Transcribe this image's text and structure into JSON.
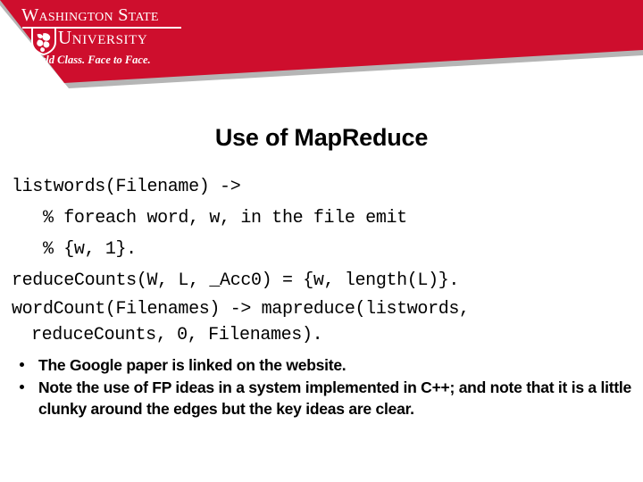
{
  "banner": {
    "brand_color": "#ce0e2d",
    "shadow_color": "#b5b5b5",
    "wordmark_line1": "Washington State",
    "wordmark_line2": "University",
    "tagline": "World Class. Face to Face.",
    "shield_icon": "wsu-cougar-shield-icon"
  },
  "slide": {
    "title": "Use of MapReduce",
    "code_lines": [
      "listwords(Filename) ->",
      "   % foreach word, w, in the file emit",
      "   % {w, 1}.",
      "reduceCounts(W, L, _Acc0) = {w, length(L)}."
    ],
    "code_wrapped": {
      "first": "wordCount(Filenames) -> mapreduce(listwords,",
      "second": "reduceCounts, 0, Filenames)."
    },
    "bullets": [
      "The Google paper is linked on the website.",
      "Note the use of FP ideas in a system implemented in C++; and note that it is a little clunky around the edges but the key ideas are clear."
    ]
  }
}
